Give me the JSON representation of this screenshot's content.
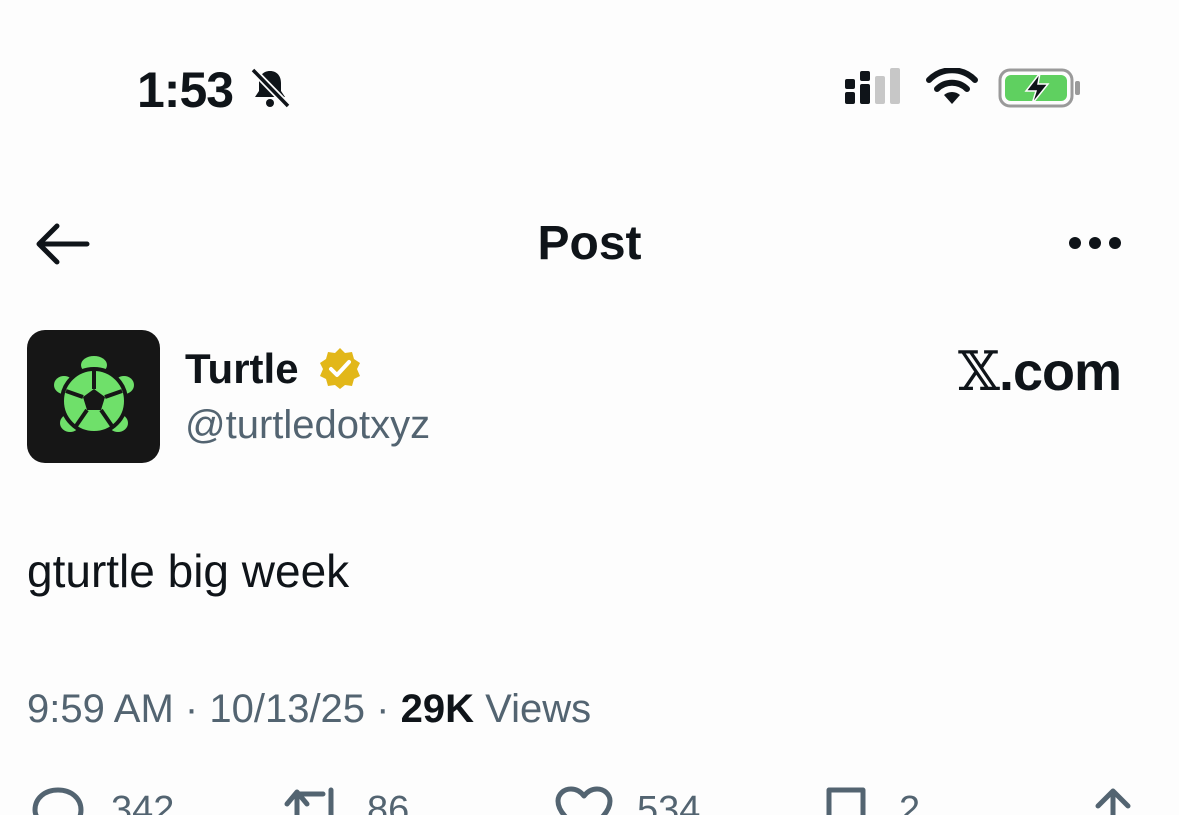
{
  "status_bar": {
    "time": "1:53",
    "icons": [
      "bell-muted-icon",
      "cellular-signal-icon",
      "wifi-icon",
      "battery-charging-icon"
    ],
    "battery_color": "#5fd060"
  },
  "nav": {
    "back_icon": "arrow-left-icon",
    "title": "Post",
    "more_icon": "more-horizontal-icon"
  },
  "author": {
    "name": "Turtle",
    "handle": "@turtledotxyz",
    "verified_badge_color": "#e2b719",
    "avatar_accent": "#6fe06a"
  },
  "source": {
    "x_glyph": "𝕏",
    "suffix": ".com"
  },
  "post": {
    "text": "gturtle big week"
  },
  "meta": {
    "time": "9:59 AM",
    "separator": "·",
    "date": "10/13/25",
    "views_count": "29K",
    "views_label": "Views"
  },
  "actions": {
    "replies": "342",
    "reposts": "86",
    "likes": "534",
    "bookmarks": "2",
    "share_icon": "share-icon"
  }
}
